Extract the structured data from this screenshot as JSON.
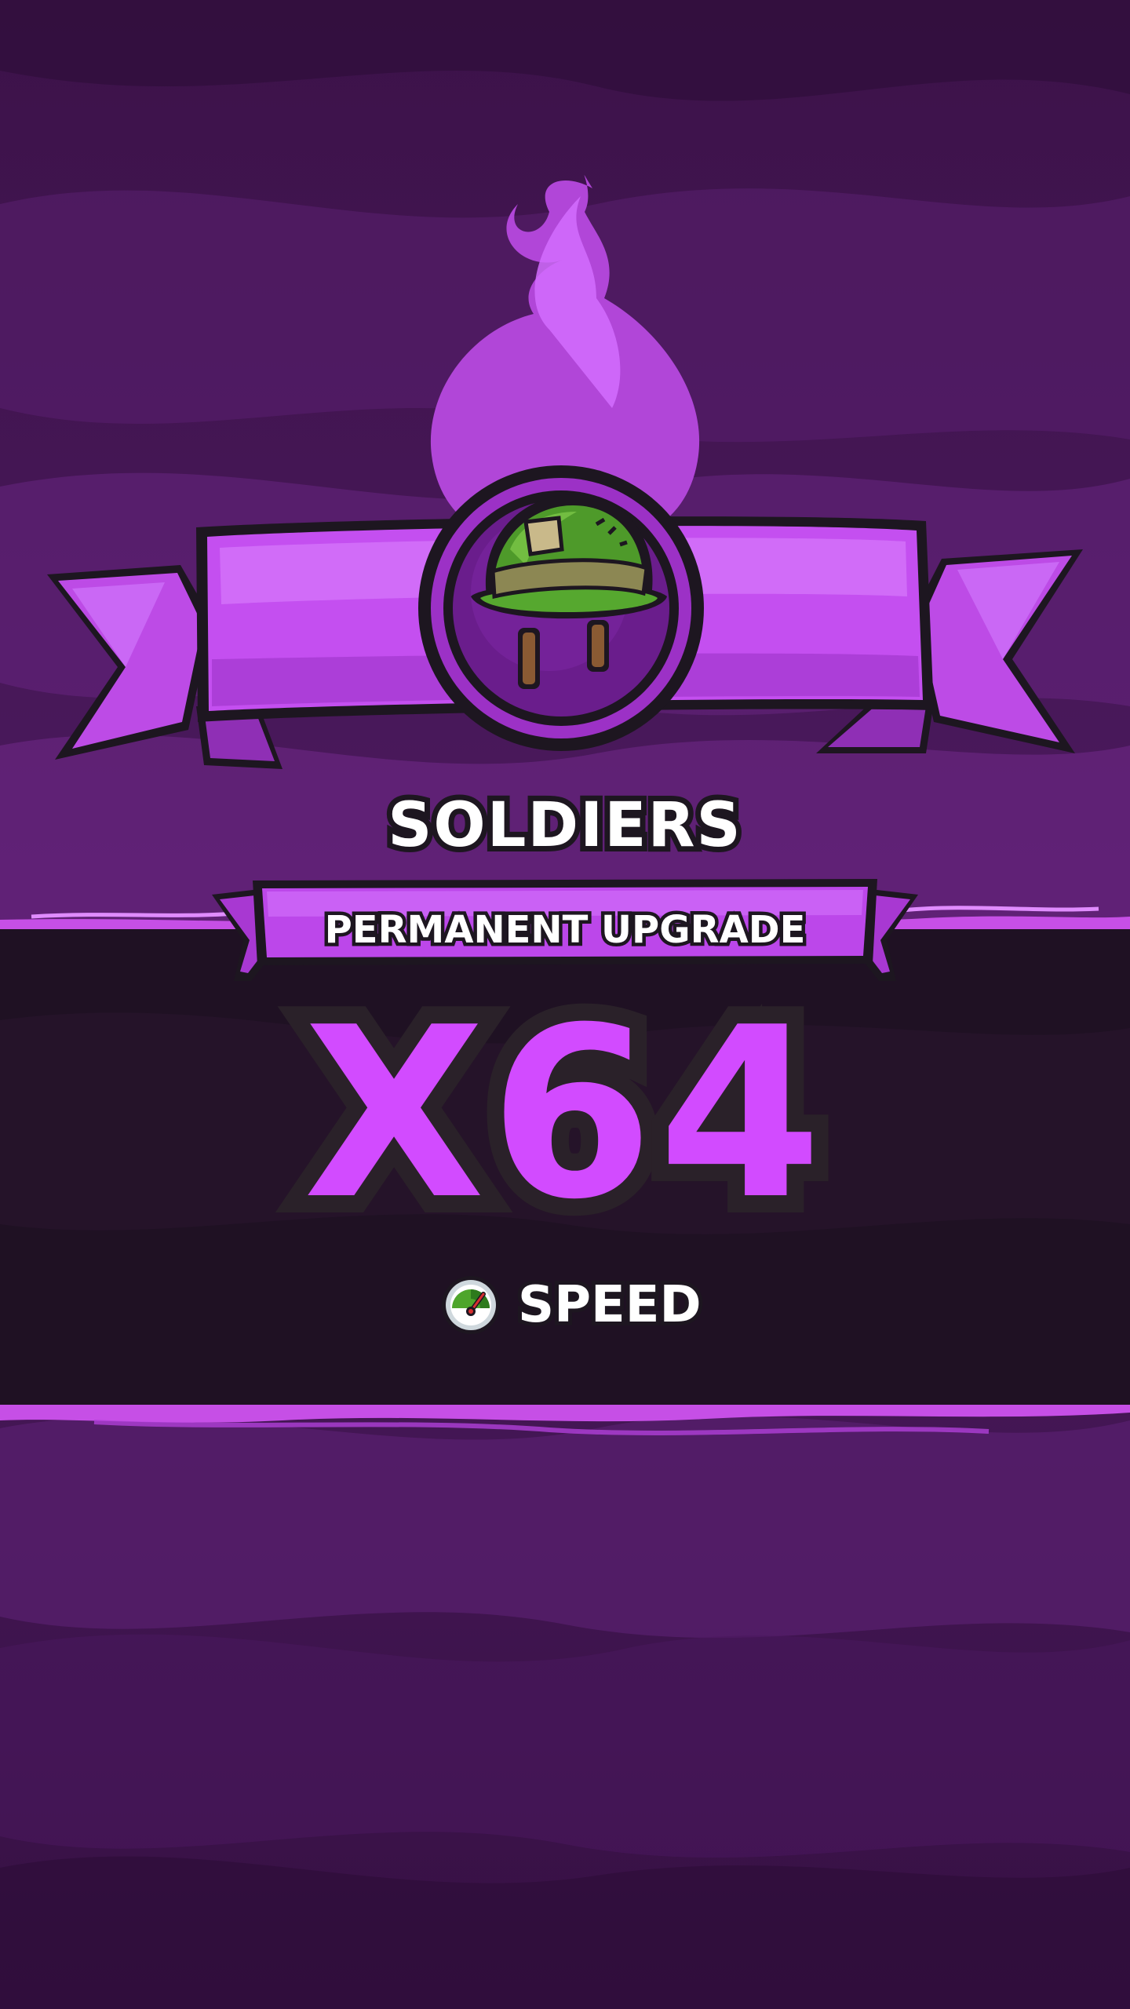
{
  "unit": {
    "name": "SOLDIERS",
    "icon": "army-helmet-icon"
  },
  "upgrade": {
    "type_label": "PERMANENT UPGRADE",
    "multiplier": "X64"
  },
  "stat": {
    "icon": "speedometer-icon",
    "label": "SPEED"
  },
  "colors": {
    "background": "#3a1148",
    "accent_purple": "#c64fe6",
    "multiplier_fill": "#d24bff",
    "dark_band": "#1f1123",
    "helmet_green": "#4e9a2a"
  }
}
